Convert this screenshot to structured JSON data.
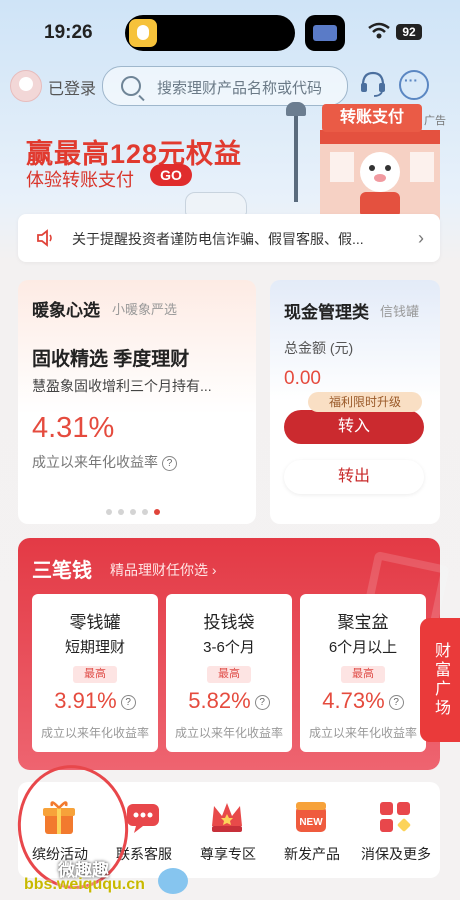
{
  "status_bar": {
    "time": "19:26",
    "battery": "92"
  },
  "header": {
    "login_status": "已登录",
    "search_placeholder": "搜索理财产品名称或代码"
  },
  "banner": {
    "title": "赢最高128元权益",
    "subtitle": "体验转账支付",
    "go_label": "GO",
    "sign": "转账支付",
    "ad_tag": "广告"
  },
  "notice": {
    "text": "关于提醒投资者谨防电信诈骗、假冒客服、假..."
  },
  "left_card": {
    "title": "暖象心选",
    "subtitle": "小暖象严选",
    "product": "固收精选 季度理财",
    "description": "慧盈象固收增利三个月持有...",
    "rate": "4.31%",
    "rate_note": "成立以来年化收益率",
    "pages": 5,
    "active_page": 5
  },
  "right_card": {
    "title": "现金管理类",
    "subtitle": "信钱罐",
    "total_label": "总金额 (元)",
    "total_amount": "0.00",
    "perk_label": "福利限时升级",
    "in_label": "转入",
    "out_label": "转出"
  },
  "three_money": {
    "title": "三笔钱",
    "subtitle": "精品理财任你选",
    "items": [
      {
        "name": "零钱罐",
        "term": "短期理财",
        "badge": "最高",
        "rate": "3.91%",
        "note": "成立以来年化收益率"
      },
      {
        "name": "投钱袋",
        "term": "3-6个月",
        "badge": "最高",
        "rate": "5.82%",
        "note": "成立以来年化收益率"
      },
      {
        "name": "聚宝盆",
        "term": "6个月以上",
        "badge": "最高",
        "rate": "4.73%",
        "note": "成立以来年化收益率"
      }
    ]
  },
  "wealth_plaza": "财富广场",
  "quick_entries": [
    {
      "label": "缤纷活动",
      "icon": "gift-icon",
      "color": "#f27a2e"
    },
    {
      "label": "联系客服",
      "icon": "chat-bubble-icon",
      "color": "#e8474b"
    },
    {
      "label": "尊享专区",
      "icon": "crown-icon",
      "color": "#e84a4a"
    },
    {
      "label": "新发产品",
      "icon": "new-box-icon",
      "color": "#ef5b3e"
    },
    {
      "label": "消保及更多",
      "icon": "grid-icon",
      "color": "#e8474b"
    }
  ],
  "watermark": {
    "line1": "微趣趣",
    "line2": "bbs.weiququ.cn"
  }
}
